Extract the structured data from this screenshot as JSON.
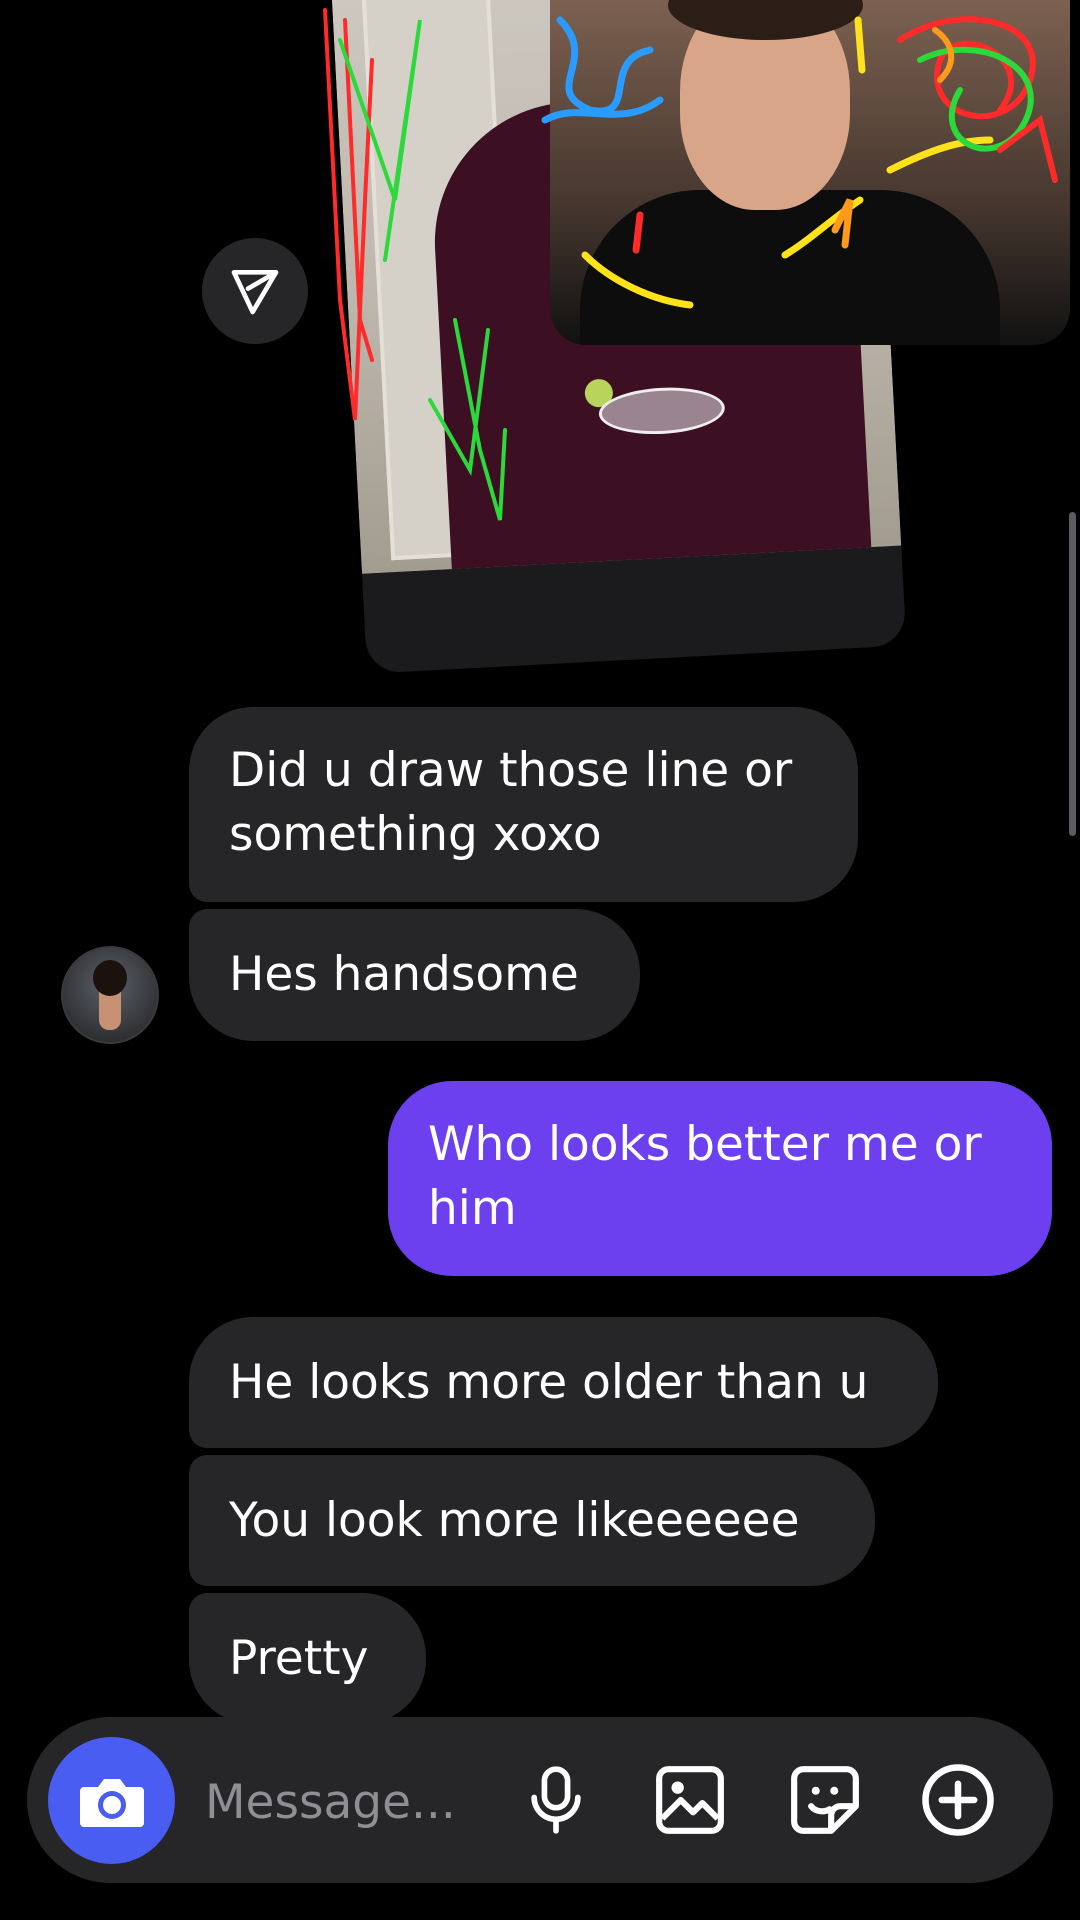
{
  "conversation": {
    "shared_media": {
      "forward_icon": "paper-plane-icon",
      "drawing_colors": [
        "#ff2a2a",
        "#2bd93a",
        "#2a9bff",
        "#ffe21a",
        "#ff9a1a"
      ]
    },
    "messages": [
      {
        "direction": "incoming",
        "text": "Did u draw those line or something xoxo"
      },
      {
        "direction": "incoming",
        "text": "Hes handsome"
      },
      {
        "direction": "outgoing",
        "text": "Who looks better me or him"
      },
      {
        "direction": "incoming",
        "text": "He looks more older than u"
      },
      {
        "direction": "incoming",
        "text": "You look more likeeeeee"
      },
      {
        "direction": "incoming",
        "text": "Pretty"
      }
    ],
    "colors": {
      "incoming_bubble": "#262628",
      "outgoing_bubble": "#6c3fef",
      "camera_button": "#4a5df2"
    }
  },
  "composer": {
    "placeholder": "Message...",
    "icons": [
      "camera-icon",
      "microphone-icon",
      "gallery-icon",
      "sticker-icon",
      "plus-circle-icon"
    ]
  }
}
